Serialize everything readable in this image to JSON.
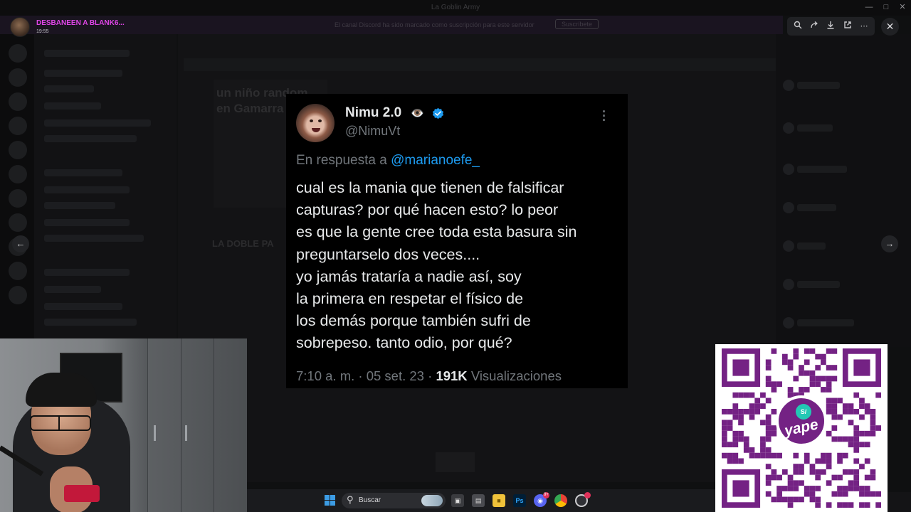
{
  "window": {
    "title": "La Goblin Army"
  },
  "stream_alert": {
    "name": "DESBANEEN A BLANK6...",
    "time": "19:55",
    "message": "El canal Discord ha sido marcado como suscripción para este servidor",
    "button": "Suscríbete"
  },
  "viewer_toolbar": {
    "zoom": "zoom-icon",
    "forward": "forward-icon",
    "download": "download-icon",
    "open": "open-external-icon",
    "more": "more-icon",
    "close": "close-icon"
  },
  "tweet": {
    "name": "Nimu 2.0",
    "emoji": "👁️",
    "handle": "@NimuVt",
    "reply_prefix": "En respuesta a",
    "reply_mention": "@marianoefe_",
    "lines": [
      "cual es la mania que tienen de falsificar",
      "capturas? por qué hacen esto? lo peor",
      "es que la gente cree toda esta basura sin",
      "preguntarselo dos veces....",
      "yo jamás trataría a nadie así, soy",
      "la primera en respetar el físico de",
      "los demás porque también sufri de",
      "sobrepeso. tanto odio, por qué?"
    ],
    "time": "7:10 a. m.",
    "date": "05 set. 23",
    "separator": "·",
    "views_count": "191K",
    "views_label": "Visualizaciones"
  },
  "backdrop": {
    "meme_text": "un niño random en Gamarra",
    "post_title": "LA DOBLE PA"
  },
  "taskbar": {
    "search_label": "Buscar",
    "apps": [
      "task-view",
      "notepad",
      "file-explorer",
      "photoshop",
      "discord",
      "chrome",
      "obs"
    ],
    "ps_label": "Ps",
    "discord_badge": "9+"
  },
  "qr": {
    "brand": "yape",
    "symbol": "S/"
  },
  "colors": {
    "accent_blue": "#1d9bf0",
    "alert_name": "#e046e8",
    "yape_purple": "#742284",
    "yape_teal": "#23c8b4"
  }
}
